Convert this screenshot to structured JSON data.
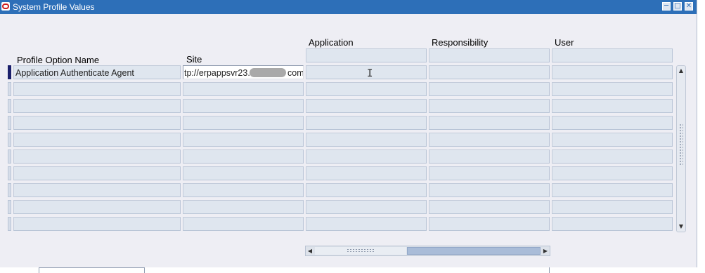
{
  "window": {
    "title": "System Profile Values",
    "controls": [
      "minimize-icon",
      "maximize-icon",
      "close-icon"
    ]
  },
  "columns": {
    "profile_option_name": "Profile Option Name",
    "site": "Site",
    "application": "Application",
    "responsibility": "Responsibility",
    "user": "User"
  },
  "rows": [
    {
      "profile_option_name": "Application Authenticate Agent",
      "site": "tp://erpappsvr23.",
      "site_tail": "com",
      "application": "",
      "responsibility": "",
      "user": ""
    },
    {
      "profile_option_name": "",
      "site": "",
      "application": "",
      "responsibility": "",
      "user": ""
    },
    {
      "profile_option_name": "",
      "site": "",
      "application": "",
      "responsibility": "",
      "user": ""
    },
    {
      "profile_option_name": "",
      "site": "",
      "application": "",
      "responsibility": "",
      "user": ""
    },
    {
      "profile_option_name": "",
      "site": "",
      "application": "",
      "responsibility": "",
      "user": ""
    },
    {
      "profile_option_name": "",
      "site": "",
      "application": "",
      "responsibility": "",
      "user": ""
    },
    {
      "profile_option_name": "",
      "site": "",
      "application": "",
      "responsibility": "",
      "user": ""
    },
    {
      "profile_option_name": "",
      "site": "",
      "application": "",
      "responsibility": "",
      "user": ""
    },
    {
      "profile_option_name": "",
      "site": "",
      "application": "",
      "responsibility": "",
      "user": ""
    },
    {
      "profile_option_name": "",
      "site": "",
      "application": "",
      "responsibility": "",
      "user": ""
    }
  ],
  "colors": {
    "titlebar": "#2d6fb8",
    "field": "#dfe6ef",
    "current_record": "#1a1f6b"
  }
}
